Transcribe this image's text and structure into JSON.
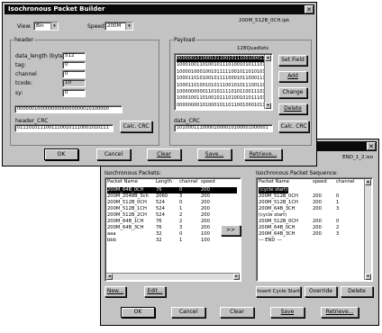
{
  "window_back": {
    "title": "",
    "filename": "END_1_2.iso",
    "close_glyph": "✕",
    "packets_label": "Isochronous Packets:",
    "packets_columns": [
      "Packet Name",
      "Length",
      "channel",
      "speed"
    ],
    "packets_rows": [
      [
        "200M_64B_0CH",
        "76",
        "0",
        "200"
      ],
      [
        "200M_2048B_3ch",
        "2060",
        "3",
        "200"
      ],
      [
        "200M_512B_0CH",
        "524",
        "0",
        "200"
      ],
      [
        "200M_512B_1CH",
        "524",
        "1",
        "200"
      ],
      [
        "200M_512B_2CH",
        "524",
        "2",
        "200"
      ],
      [
        "200M_64B_1CH",
        "76",
        "2",
        "200"
      ],
      [
        "200M_64B_3CH",
        "76",
        "3",
        "200"
      ],
      [
        "aaa",
        "32",
        "0",
        "100"
      ],
      [
        "bbb",
        "32",
        "1",
        "100"
      ]
    ],
    "sequence_label": "Isochronous Packet Sequence:",
    "sequence_columns": [
      "Packet Name",
      "speed",
      "channel"
    ],
    "sequence_rows": [
      [
        "(cycle start)",
        "",
        ""
      ],
      [
        "200M_512B_0CH",
        "200",
        "0"
      ],
      [
        "200M_512B_1CH",
        "200",
        "1"
      ],
      [
        "200M_64B_3CH",
        "200",
        "3"
      ],
      [
        "(cycle start)",
        "",
        ""
      ],
      [
        "200M_512B_0CH",
        "200",
        "0"
      ],
      [
        "200M_64B_0CH",
        "200",
        "2"
      ],
      [
        "200M_64B_3CH",
        "200",
        "3"
      ],
      [
        "--- END ---",
        "",
        ""
      ]
    ],
    "move_button": ">>",
    "new_button": "New...",
    "edit_button": "Edit...",
    "insert_cycle_start_button": "Insert Cycle Start",
    "override_button": "Override",
    "delete_button": "Delete",
    "ok_button": "OK",
    "cancel_button": "Cancel",
    "clear_button": "Clear",
    "save_button": "Save",
    "retrieve_button": "Retrieve..."
  },
  "window_front": {
    "title": "Isochronous Packet Builder",
    "close_glyph": "✕",
    "filename": "200M_512B_0CH.ipk",
    "view_label": "View:",
    "view_value": "Bin",
    "speed_label": "Speed:",
    "speed_value": "200M",
    "header_group": "header",
    "data_length_label": "data_length (bytes)",
    "data_length_value": "512",
    "tag_label": "tag:",
    "tag_value": "0",
    "channel_label": "channel",
    "channel_value": "0",
    "tcode_label": "tcode:",
    "tcode_value": "10",
    "sy_label": "sy:",
    "sy_value": "0",
    "header_binary": "00000010000000000000000010100000",
    "header_crc_label": "header_CRC",
    "header_crc_value": "01110101110011100101110001010111",
    "calc_crc_button": "Calc. CRC",
    "payload_group": "Payload",
    "payload_count": "128Quadlets",
    "payload_rows": [
      "00000010100010110010111001000111",
      "10001001101001011101001010111011",
      "10000100010010111110010110101011",
      "10001101010010111100010110001111",
      "10001101001010111001010111001101",
      "10000000001101011110101100111011",
      "10001001101001011101001010111011",
      "00000000101000101101100100010111"
    ],
    "set_field_button": "Set Field",
    "add_button": "Add",
    "change_button": "Change",
    "delete_button": "Delete",
    "data_crc_label": "data_CRC",
    "data_crc_value": "10100011100001000010100001000001",
    "calc_crc_button2": "Calc. CRC",
    "ok_button": "OK",
    "cancel_button": "Cancel",
    "clear_button": "Clear",
    "save_button": "Save...",
    "retrieve_button": "Retrieve..."
  }
}
